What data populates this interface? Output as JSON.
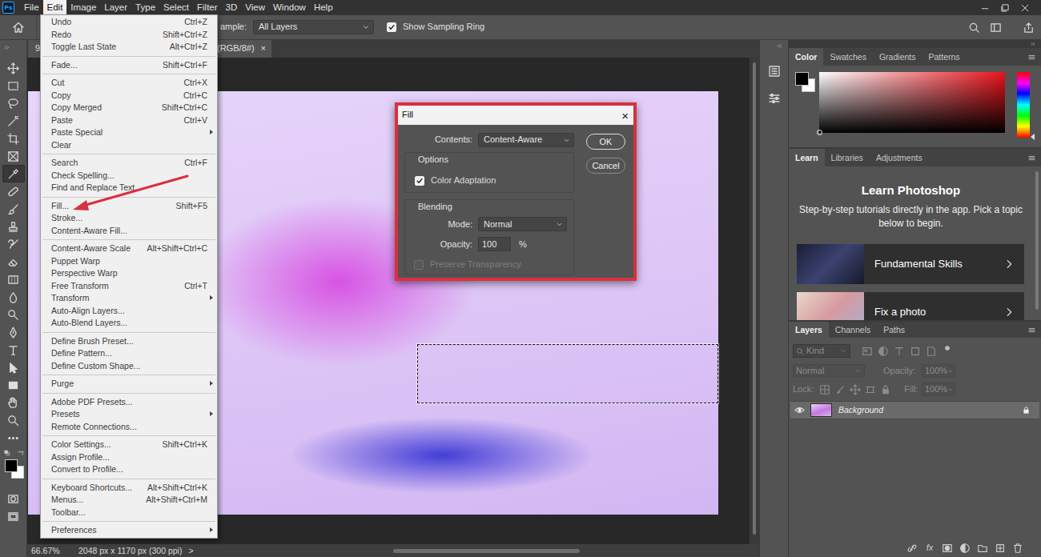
{
  "app": {
    "logo": "Ps"
  },
  "menubar": [
    {
      "label": "File",
      "selected": false
    },
    {
      "label": "Edit",
      "selected": true
    },
    {
      "label": "Image",
      "selected": false
    },
    {
      "label": "Layer",
      "selected": false
    },
    {
      "label": "Type",
      "selected": false
    },
    {
      "label": "Select",
      "selected": false
    },
    {
      "label": "Filter",
      "selected": false
    },
    {
      "label": "3D",
      "selected": false
    },
    {
      "label": "View",
      "selected": false
    },
    {
      "label": "Window",
      "selected": false
    },
    {
      "label": "Help",
      "selected": false
    }
  ],
  "options_bar": {
    "sample_label": "ample:",
    "sample_value": "All Layers",
    "sampling_ring": {
      "label": "Show Sampling Ring",
      "checked": true
    }
  },
  "toolbar": {
    "tools": [
      {
        "selected": false
      },
      {
        "selected": false
      },
      {
        "selected": false
      },
      {
        "selected": false
      },
      {
        "selected": false
      },
      {
        "selected": false
      },
      {
        "selected": true
      },
      {
        "selected": false
      },
      {
        "selected": false
      },
      {
        "selected": false
      },
      {
        "selected": false
      },
      {
        "selected": false
      },
      {
        "selected": false
      },
      {
        "selected": false
      },
      {
        "selected": false
      },
      {
        "selected": false
      },
      {
        "selected": false
      },
      {
        "selected": false
      },
      {
        "selected": false
      },
      {
        "selected": false
      },
      {
        "selected": false
      },
      {
        "selected": false
      }
    ],
    "colors": [
      {
        "color": "#000000"
      },
      {
        "color": "#ffffff"
      }
    ]
  },
  "document": {
    "tab_start": "9",
    "tab_end": "(RGB/8#)",
    "close": "×",
    "vscroll": {
      "start": 0.01,
      "level": 0.97
    },
    "hscroll": {
      "start": 0.35,
      "level": 0.34
    }
  },
  "status_bar": {
    "zoom": "66.67%",
    "size": "2048 px x 1170 px (300 ppi)",
    "more": ">"
  },
  "edit_menu": {
    "groups": [
      [
        {
          "label": "Undo",
          "shortcut": "Ctrl+Z",
          "submenu": false
        },
        {
          "label": "Redo",
          "shortcut": "Shift+Ctrl+Z",
          "submenu": false
        },
        {
          "label": "Toggle Last State",
          "shortcut": "Alt+Ctrl+Z",
          "submenu": false
        }
      ],
      [
        {
          "label": "Fade...",
          "shortcut": "Shift+Ctrl+F",
          "submenu": false
        }
      ],
      [
        {
          "label": "Cut",
          "shortcut": "Ctrl+X",
          "submenu": false
        },
        {
          "label": "Copy",
          "shortcut": "Ctrl+C",
          "submenu": false
        },
        {
          "label": "Copy Merged",
          "shortcut": "Shift+Ctrl+C",
          "submenu": false
        },
        {
          "label": "Paste",
          "shortcut": "Ctrl+V",
          "submenu": false
        },
        {
          "label": "Paste Special",
          "submenu": true
        },
        {
          "label": "Clear",
          "submenu": false
        }
      ],
      [
        {
          "label": "Search",
          "shortcut": "Ctrl+F",
          "submenu": false
        },
        {
          "label": "Check Spelling...",
          "submenu": false
        },
        {
          "label": "Find and Replace Text...",
          "submenu": false
        }
      ],
      [
        {
          "label": "Fill...",
          "shortcut": "Shift+F5",
          "submenu": false
        },
        {
          "label": "Stroke...",
          "submenu": false
        },
        {
          "label": "Content-Aware Fill...",
          "submenu": false
        }
      ],
      [
        {
          "label": "Content-Aware Scale",
          "shortcut": "Alt+Shift+Ctrl+C",
          "submenu": false
        },
        {
          "label": "Puppet Warp",
          "submenu": false
        },
        {
          "label": "Perspective Warp",
          "submenu": false
        },
        {
          "label": "Free Transform",
          "shortcut": "Ctrl+T",
          "submenu": false
        },
        {
          "label": "Transform",
          "submenu": true
        },
        {
          "label": "Auto-Align Layers...",
          "submenu": false
        },
        {
          "label": "Auto-Blend Layers...",
          "submenu": false
        }
      ],
      [
        {
          "label": "Define Brush Preset...",
          "submenu": false
        },
        {
          "label": "Define Pattern...",
          "submenu": false
        },
        {
          "label": "Define Custom Shape...",
          "submenu": false
        }
      ],
      [
        {
          "label": "Purge",
          "submenu": true
        }
      ],
      [
        {
          "label": "Adobe PDF Presets...",
          "submenu": false
        },
        {
          "label": "Presets",
          "submenu": true
        },
        {
          "label": "Remote Connections...",
          "submenu": false
        }
      ],
      [
        {
          "label": "Color Settings...",
          "shortcut": "Shift+Ctrl+K",
          "submenu": false
        },
        {
          "label": "Assign Profile...",
          "submenu": false
        },
        {
          "label": "Convert to Profile...",
          "submenu": false
        }
      ],
      [
        {
          "label": "Keyboard Shortcuts...",
          "shortcut": "Alt+Shift+Ctrl+K",
          "submenu": false
        },
        {
          "label": "Menus...",
          "shortcut": "Alt+Shift+Ctrl+M",
          "submenu": false
        },
        {
          "label": "Toolbar...",
          "submenu": false
        }
      ],
      [
        {
          "label": "Preferences",
          "submenu": true
        }
      ]
    ]
  },
  "fill_dialog": {
    "title": "Fill",
    "close": "×",
    "contents_label": "Contents:",
    "contents_value": "Content-Aware",
    "options_legend": "Options",
    "color_adaptation": {
      "label": "Color Adaptation",
      "checked": true,
      "disabled": false
    },
    "blending_legend": "Blending",
    "mode_label": "Mode:",
    "mode_value": "Normal",
    "opacity_label": "Opacity:",
    "opacity_value": "100",
    "opacity_unit": "%",
    "preserve_transparency": {
      "label": "Preserve Transparency",
      "checked": false,
      "disabled": true
    },
    "buttons": [
      {
        "label": "OK",
        "default": true
      },
      {
        "label": "Cancel",
        "default": false
      }
    ]
  },
  "color_panel": {
    "tabs": [
      {
        "label": "Color",
        "selected": true
      },
      {
        "label": "Swatches",
        "selected": false
      },
      {
        "label": "Gradients",
        "selected": false
      },
      {
        "label": "Patterns",
        "selected": false
      }
    ],
    "swatches": [
      {
        "color": "#000000"
      },
      {
        "color": "#ffffff"
      }
    ]
  },
  "learn_panel": {
    "tabs": [
      {
        "label": "Learn",
        "selected": true
      },
      {
        "label": "Libraries",
        "selected": false
      },
      {
        "label": "Adjustments",
        "selected": false
      }
    ],
    "title": "Learn Photoshop",
    "text": "Step-by-step tutorials directly in the app. Pick a topic below to begin.",
    "cards": [
      {
        "label": "Fundamental Skills"
      },
      {
        "label": "Fix a photo"
      }
    ],
    "scroll": {
      "start": 0.03,
      "level": 0.9
    }
  },
  "layers_panel": {
    "tabs": [
      {
        "label": "Layers",
        "selected": true
      },
      {
        "label": "Channels",
        "selected": false
      },
      {
        "label": "Paths",
        "selected": false
      }
    ],
    "filter": {
      "placeholder": "Kind",
      "disabled": true
    },
    "blend_mode": {
      "value": "Normal",
      "disabled": true
    },
    "opacity": {
      "label": "Opacity:",
      "value": "100%",
      "disabled": true
    },
    "lock_label": "Lock:",
    "fill": {
      "label": "Fill:",
      "value": "100%",
      "disabled": true
    },
    "layers": [
      {
        "name": "Background",
        "visible": true,
        "locked": true,
        "selected": true
      }
    ],
    "fx_label": "fx"
  }
}
